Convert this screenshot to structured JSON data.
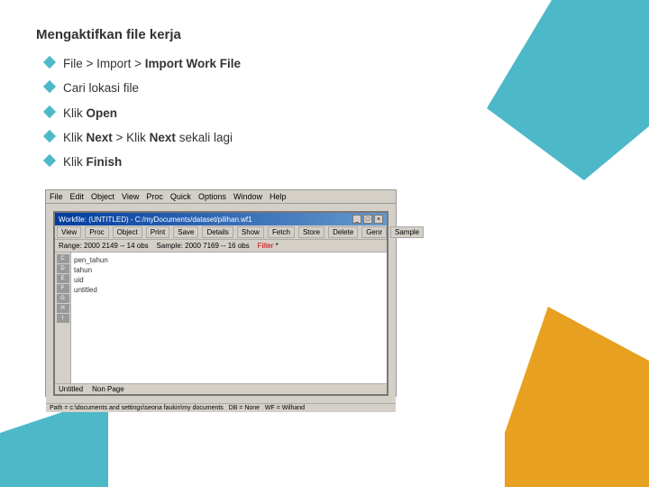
{
  "page": {
    "title": "Mengaktifkan file kerja",
    "bullets": [
      {
        "id": 1,
        "text_plain": "File > Import > Import Work File",
        "segments": [
          {
            "text": "File",
            "bold": false
          },
          {
            "text": " > Import > ",
            "bold": false
          },
          {
            "text": "Import Work File",
            "bold": true
          }
        ]
      },
      {
        "id": 2,
        "text_plain": "Cari lokasi file",
        "segments": [
          {
            "text": "Cari lokasi file",
            "bold": false
          }
        ]
      },
      {
        "id": 3,
        "text_plain": "Klik Open",
        "segments": [
          {
            "text": "Klik ",
            "bold": false
          },
          {
            "text": "Open",
            "bold": true
          }
        ]
      },
      {
        "id": 4,
        "text_plain": "Klik Next > Klik Next sekali lagi",
        "segments": [
          {
            "text": "Klik ",
            "bold": false
          },
          {
            "text": "Next",
            "bold": true
          },
          {
            "text": " > Klik ",
            "bold": false
          },
          {
            "text": "Next",
            "bold": true
          },
          {
            "text": " sekali lagi",
            "bold": false
          }
        ]
      },
      {
        "id": 5,
        "text_plain": "Klik Finish",
        "segments": [
          {
            "text": "Klik ",
            "bold": false
          },
          {
            "text": "Finish",
            "bold": true
          }
        ]
      }
    ]
  },
  "screenshot": {
    "menu_items": [
      "File",
      "Edit",
      "Object",
      "View",
      "Proc",
      "Quick",
      "Options",
      "Window",
      "Help"
    ],
    "window_title": "Workfile: (UNTITLED) - C:/myDocuments/dataset/pilihan.wf1",
    "toolbar_buttons": [
      "View",
      "Proc",
      "Object",
      "Print",
      "Save",
      "Details",
      "Show",
      "Fetch",
      "Store",
      "Delete",
      "Genr",
      "Sample"
    ],
    "range_label": "Range:",
    "range_value": "2000 2149 -- 14 obs",
    "sample_label": "Sample:",
    "sample_value": "2000 7169 -- 16 obs",
    "sidebar_items": [
      "C",
      "D",
      "E",
      "F",
      "G",
      "H",
      "I"
    ],
    "data_rows": [
      "pen_tahun",
      "tahun",
      "uid",
      "untitled"
    ],
    "status_items": [
      "Untitled",
      "Non Page"
    ]
  },
  "colors": {
    "accent_teal": "#4db8c8",
    "accent_orange": "#e8a020",
    "diamond": "#5ab8c5"
  }
}
